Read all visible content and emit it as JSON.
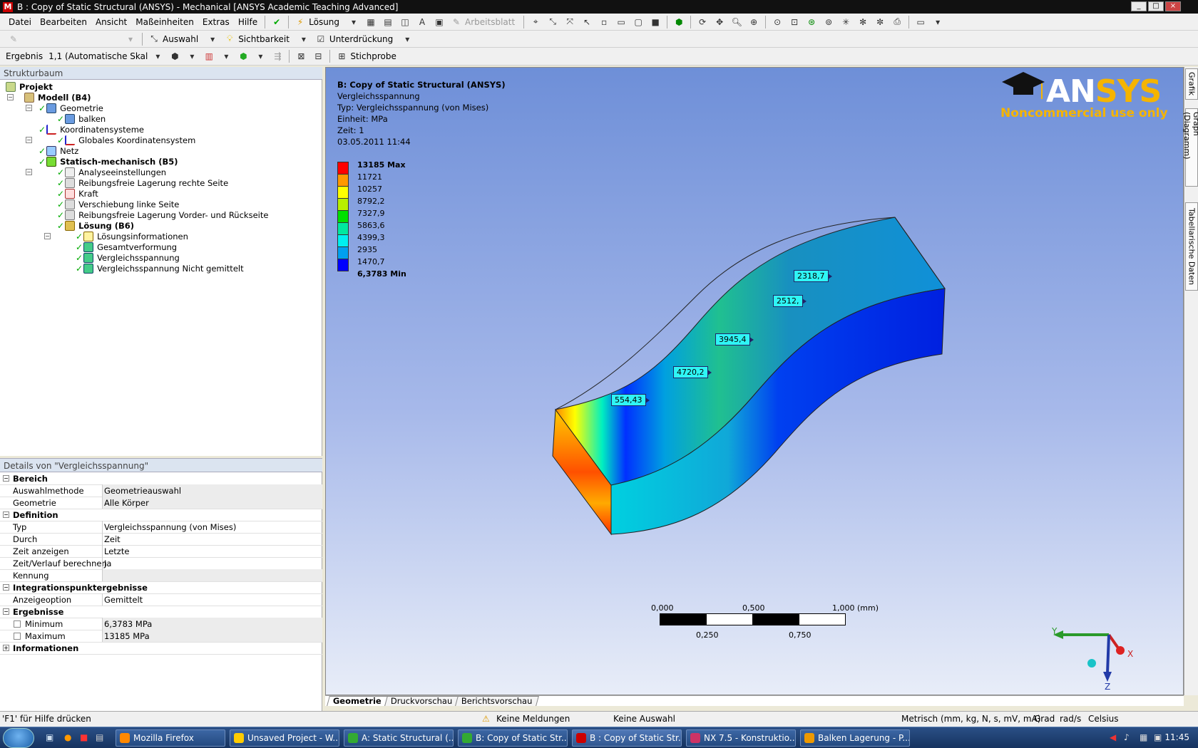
{
  "window": {
    "title": "B : Copy of Static Structural (ANSYS) - Mechanical [ANSYS Academic Teaching Advanced]",
    "controls": [
      "_",
      "□",
      "×"
    ]
  },
  "menu": [
    "Datei",
    "Bearbeiten",
    "Ansicht",
    "Maßeinheiten",
    "Extras",
    "Hilfe"
  ],
  "toolbar1": {
    "solve_label": "Lösung",
    "worksheet_label": "Arbeitsblatt"
  },
  "toolbar2": {
    "selection_label": "Auswahl",
    "visibility_label": "Sichtbarkeit",
    "suppression_label": "Unterdrückung"
  },
  "toolbar3": {
    "result_label": "Ergebnis",
    "scale_value": "1,1 (Automatische Skal",
    "probe_label": "Stichprobe"
  },
  "tree": {
    "header": "Strukturbaum",
    "nodes": [
      "Projekt",
      "Modell (B4)",
      "Geometrie",
      "balken",
      "Koordinatensysteme",
      "Globales Koordinatensystem",
      "Netz",
      "Statisch-mechanisch (B5)",
      "Analyseeinstellungen",
      "Reibungsfreie Lagerung rechte Seite",
      "Kraft",
      "Verschiebung linke Seite",
      "Reibungsfreie Lagerung Vorder- und Rückseite",
      "Lösung (B6)",
      "Lösungsinformationen",
      "Gesamtverformung",
      "Vergleichsspannung",
      "Vergleichsspannung  Nicht gemittelt"
    ]
  },
  "details": {
    "header": "Details von \"Vergleichsspannung\"",
    "rows": [
      {
        "k": "Bereich",
        "sec": true
      },
      {
        "k": "Auswahlmethode",
        "v": "Geometrieauswahl"
      },
      {
        "k": "Geometrie",
        "v": "Alle Körper"
      },
      {
        "k": "Definition",
        "sec": true
      },
      {
        "k": "Typ",
        "v": "Vergleichsspannung (von Mises)"
      },
      {
        "k": "Durch",
        "v": "Zeit"
      },
      {
        "k": "Zeit anzeigen",
        "v": "Letzte"
      },
      {
        "k": "Zeit/Verlauf berechnen",
        "v": "Ja"
      },
      {
        "k": "Kennung",
        "v": ""
      },
      {
        "k": "Integrationspunktergebnisse",
        "sec": true
      },
      {
        "k": "Anzeigeoption",
        "v": "Gemittelt"
      },
      {
        "k": "Ergebnisse",
        "sec": true
      },
      {
        "k": "Minimum",
        "v": "6,3783 MPa",
        "box": true
      },
      {
        "k": "Maximum",
        "v": "13185 MPa",
        "box": true
      },
      {
        "k": "Informationen",
        "sec": true,
        "plus": true
      }
    ]
  },
  "viewport": {
    "info": [
      "B: Copy of Static Structural (ANSYS)",
      "Vergleichsspannung",
      "Typ: Vergleichsspannung (von Mises)",
      "Einheit: MPa",
      "Zeit: 1",
      "03.05.2011 11:44"
    ],
    "legend": {
      "labels": [
        "13185 Max",
        "11721",
        "10257",
        "8792,2",
        "7327,9",
        "5863,6",
        "4399,3",
        "2935",
        "1470,7",
        "6,3783 Min"
      ],
      "colors": [
        "#ff0000",
        "#ff9900",
        "#ffff00",
        "#b8f000",
        "#00e000",
        "#00e8a0",
        "#00f0f0",
        "#00a0f0",
        "#0000ff"
      ]
    },
    "brand": {
      "a": "AN",
      "b": "SYS",
      "sub": "Noncommercial use only"
    },
    "probes": [
      {
        "label": "2318,7"
      },
      {
        "label": "2512,"
      },
      {
        "label": "3945,4"
      },
      {
        "label": "4720,2"
      },
      {
        "label": "554,43"
      }
    ],
    "scale": {
      "top": [
        "0,000",
        "0,500",
        "1,000 (mm)"
      ],
      "bottom": [
        "0,250",
        "0,750"
      ]
    },
    "axes": {
      "x": "X",
      "y": "Y",
      "z": "Z"
    }
  },
  "view_tabs": [
    "Geometrie",
    "Druckvorschau",
    "Berichtsvorschau"
  ],
  "side_tabs": [
    "Grafik",
    "Graph (Diagramm)",
    "Tabellarische Daten"
  ],
  "status": {
    "help": "'F1' für Hilfe drücken",
    "messages": "Keine Meldungen",
    "selection": "Keine Auswahl",
    "units": "Metrisch (mm, kg, N, s, mV, mA)",
    "angle": "Grad",
    "rot": "rad/s",
    "temp": "Celsius"
  },
  "taskbar": {
    "items": [
      "Mozilla Firefox",
      "Unsaved Project - W...",
      "A: Static Structural (...",
      "B: Copy of Static Str...",
      "B : Copy of Static Str...",
      "NX 7.5 - Konstruktio...",
      "Balken Lagerung - P..."
    ],
    "clock": "11:45"
  }
}
